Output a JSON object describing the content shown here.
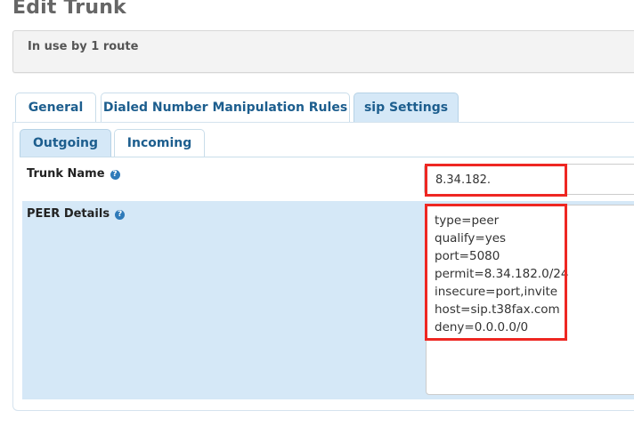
{
  "page": {
    "title": "Edit Trunk",
    "usage_info": "In use by 1 route"
  },
  "tabs": [
    {
      "label": "General",
      "active": false
    },
    {
      "label": "Dialed Number Manipulation Rules",
      "active": false
    },
    {
      "label": "sip Settings",
      "active": true
    }
  ],
  "subtabs": [
    {
      "label": "Outgoing",
      "active": true
    },
    {
      "label": "Incoming",
      "active": false
    }
  ],
  "form": {
    "trunk_name": {
      "label": "Trunk Name",
      "value": "8.34.182."
    },
    "peer_details": {
      "label": "PEER Details",
      "value": "type=peer\nqualify=yes\nport=5080\npermit=8.34.182.0/24\ninsecure=port,invite\nhost=sip.t38fax.com\ndeny=0.0.0.0/0"
    }
  },
  "help_icon_glyph": "?",
  "colors": {
    "tab_text": "#1d5e8e",
    "active_tab_bg": "#d5e8f7",
    "highlight": "#ee2722",
    "help_icon": "#2e7ab9"
  }
}
